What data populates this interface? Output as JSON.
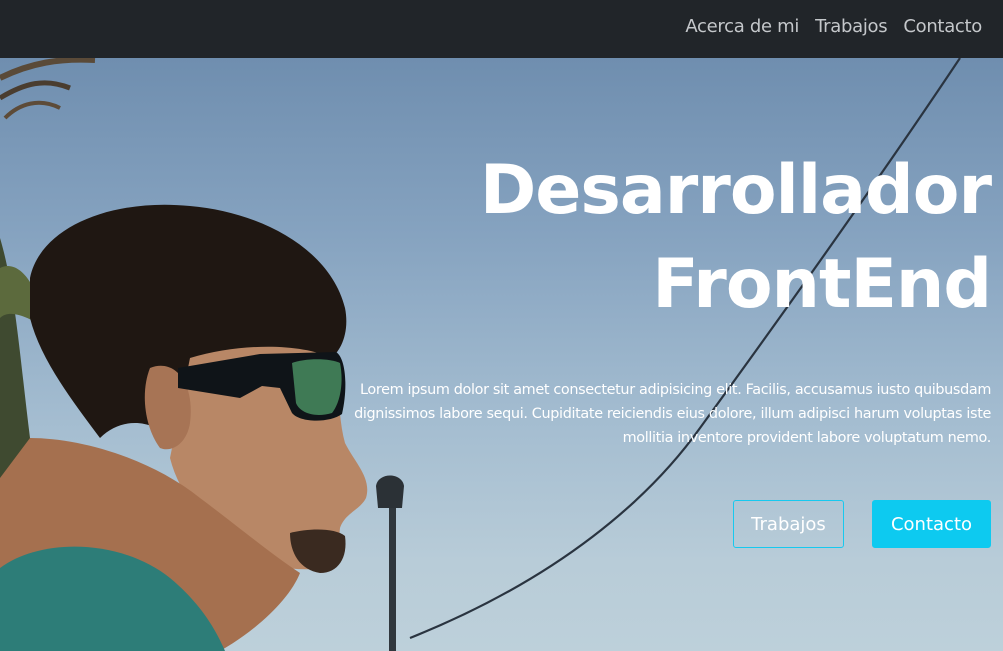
{
  "navbar": {
    "links": [
      {
        "label": "Acerca de mi"
      },
      {
        "label": "Trabajos"
      },
      {
        "label": "Contacto"
      }
    ]
  },
  "hero": {
    "title_line1": "Desarrollador",
    "title_line2": "FrontEnd",
    "text": "Lorem ipsum dolor sit amet consectetur adipisicing elit. Facilis, accusamus iusto quibusdam dignissimos labore sequi. Cupiditate reiciendis eius dolore, illum adipisci harum voluptas iste mollitia inventore provident labore voluptatum nemo.",
    "buttons": {
      "works_label": "Trabajos",
      "contact_label": "Contacto"
    }
  },
  "colors": {
    "navbar_bg": "#212529",
    "accent": "#0dcaf0",
    "nav_text": "#c4c7ca"
  }
}
